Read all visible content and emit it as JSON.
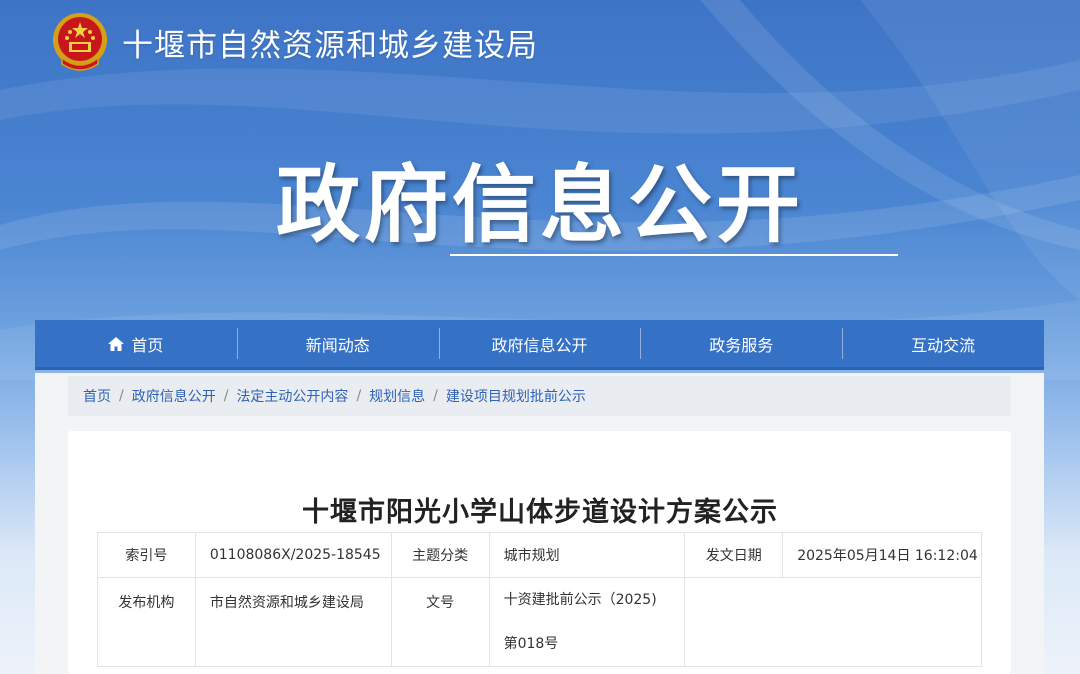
{
  "site": {
    "title": "十堰市自然资源和城乡建设局",
    "emblem_icon": "national-emblem-icon"
  },
  "hero": {
    "title": "政府信息公开"
  },
  "nav": {
    "items": [
      {
        "label": "首页",
        "icon": "home-icon"
      },
      {
        "label": "新闻动态"
      },
      {
        "label": "政府信息公开"
      },
      {
        "label": "政务服务"
      },
      {
        "label": "互动交流"
      }
    ]
  },
  "breadcrumb": {
    "items": [
      "首页",
      "政府信息公开",
      "法定主动公开内容",
      "规划信息",
      "建设项目规划批前公示"
    ],
    "separator": "/"
  },
  "article": {
    "title": "十堰市阳光小学山体步道设计方案公示",
    "meta": {
      "index_label": "索引号",
      "index_value": "01108086X/2025-18545",
      "category_label": "主题分类",
      "category_value": "城市规划",
      "date_label": "发文日期",
      "date_value": "2025年05月14日 16:12:04",
      "publisher_label": "发布机构",
      "publisher_value": "市自然资源和城乡建设局",
      "docno_label": "文号",
      "docno_value_line1": "十资建批前公示（2025)",
      "docno_value_line2": "第018号"
    }
  },
  "colors": {
    "nav_bg": "#3571c4",
    "link": "#2f63b5",
    "banner_top": "#3e74c6"
  }
}
